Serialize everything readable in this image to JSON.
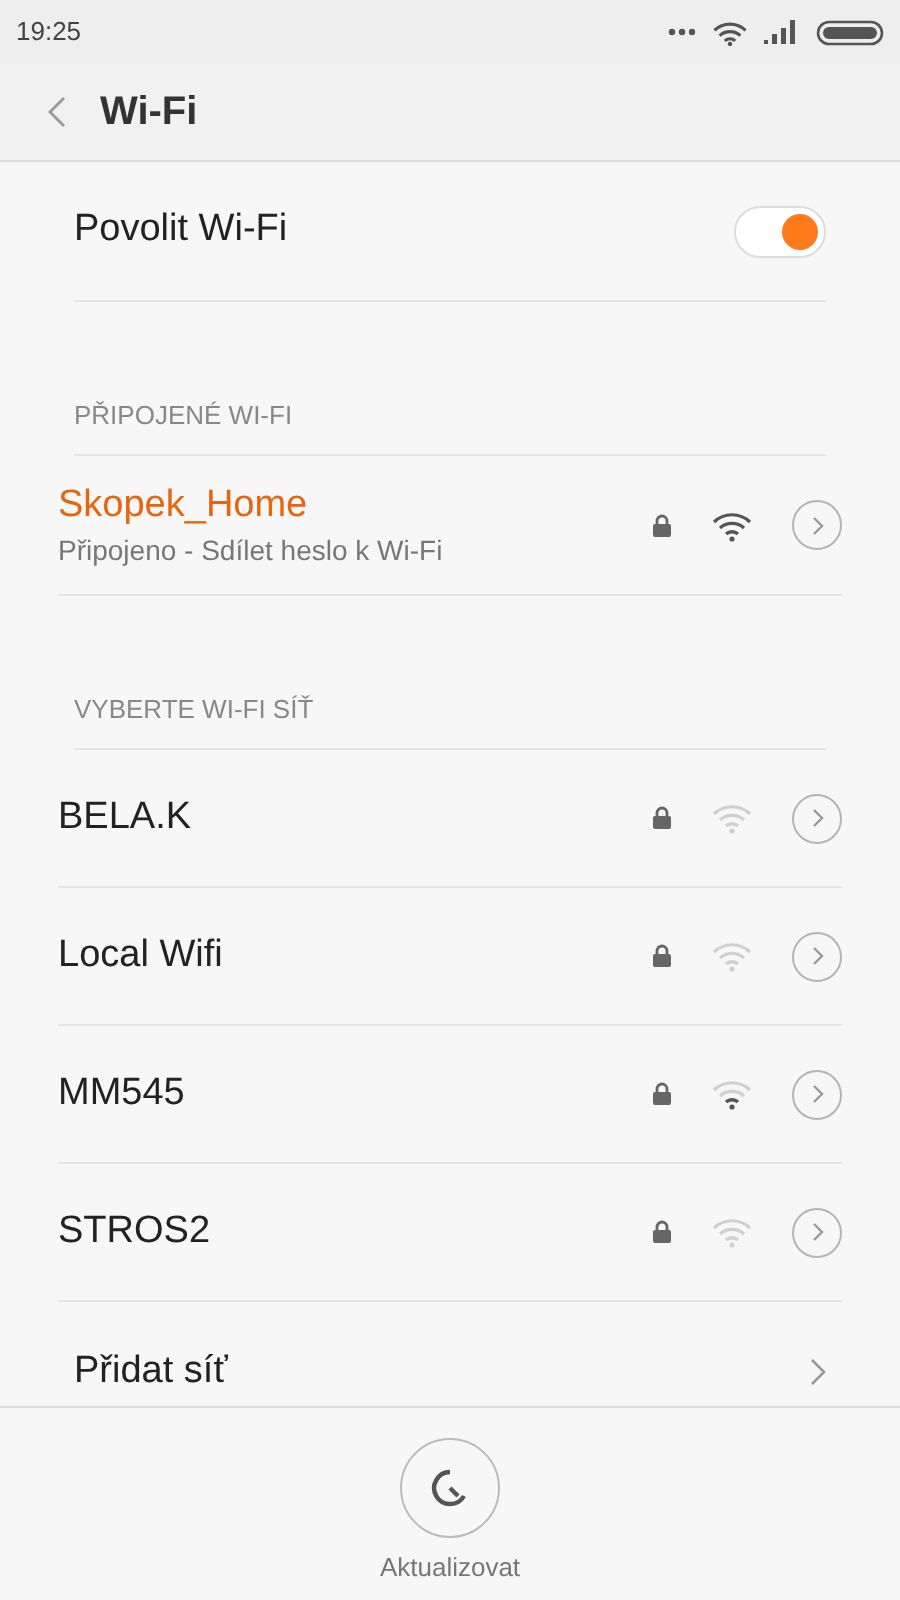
{
  "status_bar": {
    "time": "19:25"
  },
  "header": {
    "title": "Wi-Fi"
  },
  "wifi_toggle": {
    "label": "Povolit Wi-Fi",
    "on": true
  },
  "connected_section": {
    "title": "PŘIPOJENÉ WI-FI",
    "network": {
      "name": "Skopek_Home",
      "status": "Připojeno - Sdílet heslo k Wi-Fi",
      "secured": true,
      "kind": "strong"
    }
  },
  "available_section": {
    "title": "VYBERTE WI-FI SÍŤ",
    "networks": [
      {
        "name": "BELA.K",
        "secured": true,
        "kind": "faint"
      },
      {
        "name": "Local Wifi",
        "secured": true,
        "kind": "faint"
      },
      {
        "name": "MM545",
        "secured": true,
        "kind": "weak"
      },
      {
        "name": "STROS2",
        "secured": true,
        "kind": "faint"
      }
    ]
  },
  "add_network": {
    "label": "Přidat síť"
  },
  "refresh_button": {
    "label": "Aktualizovat"
  }
}
